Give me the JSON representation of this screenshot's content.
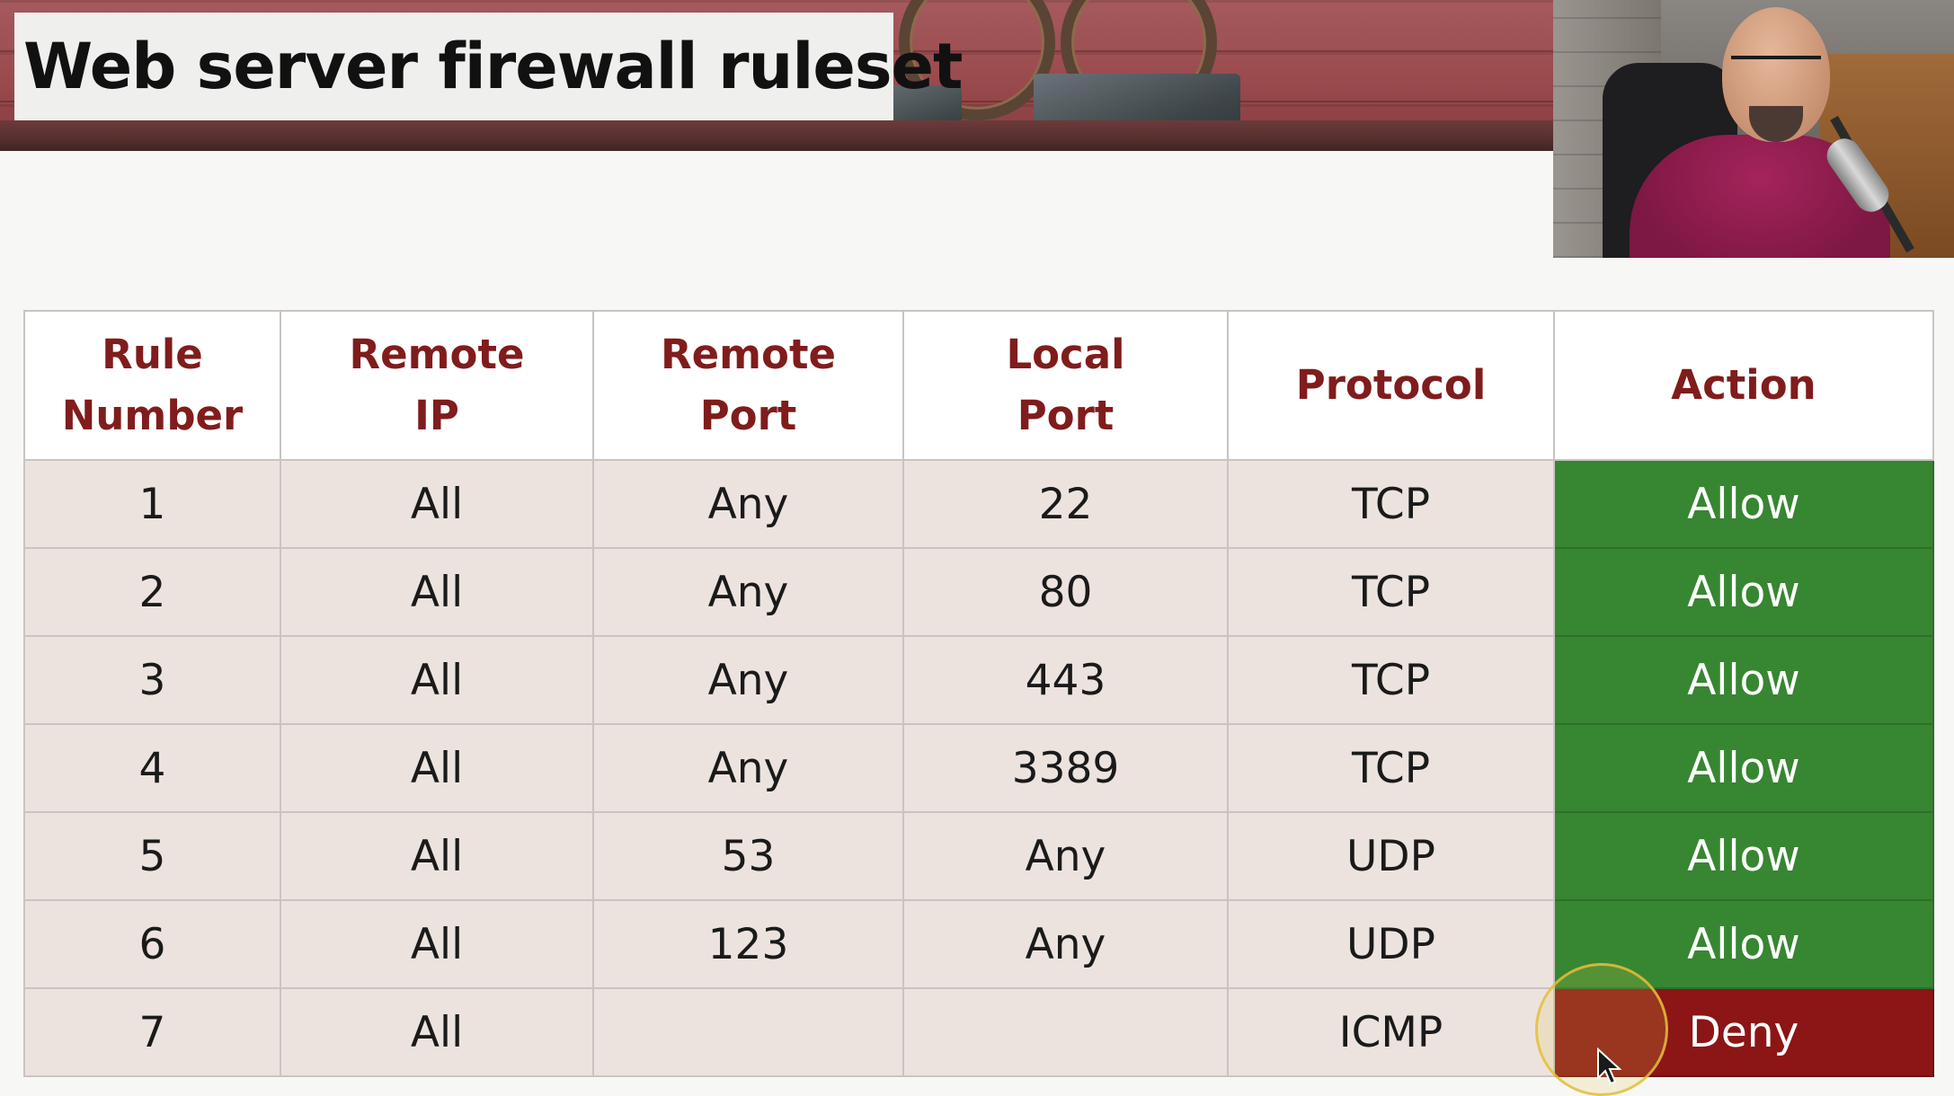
{
  "slide": {
    "title": "Web server firewall ruleset"
  },
  "table": {
    "headers": [
      [
        "Rule",
        "Number"
      ],
      [
        "Remote",
        "IP"
      ],
      [
        "Remote",
        "Port"
      ],
      [
        "Local",
        "Port"
      ],
      [
        "Protocol"
      ],
      [
        "Action"
      ]
    ],
    "rows": [
      {
        "rule": "1",
        "remote_ip": "All",
        "remote_port": "Any",
        "local_port": "22",
        "protocol": "TCP",
        "action": "Allow"
      },
      {
        "rule": "2",
        "remote_ip": "All",
        "remote_port": "Any",
        "local_port": "80",
        "protocol": "TCP",
        "action": "Allow"
      },
      {
        "rule": "3",
        "remote_ip": "All",
        "remote_port": "Any",
        "local_port": "443",
        "protocol": "TCP",
        "action": "Allow"
      },
      {
        "rule": "4",
        "remote_ip": "All",
        "remote_port": "Any",
        "local_port": "3389",
        "protocol": "TCP",
        "action": "Allow"
      },
      {
        "rule": "5",
        "remote_ip": "All",
        "remote_port": "53",
        "local_port": "Any",
        "protocol": "UDP",
        "action": "Allow"
      },
      {
        "rule": "6",
        "remote_ip": "All",
        "remote_port": "123",
        "local_port": "Any",
        "protocol": "UDP",
        "action": "Allow"
      },
      {
        "rule": "7",
        "remote_ip": "All",
        "remote_port": "",
        "local_port": "",
        "protocol": "ICMP",
        "action": "Deny"
      }
    ]
  },
  "colors": {
    "header_text": "#801c1c",
    "allow": "#378632",
    "deny": "#8c1515",
    "row_bg": "#ece3df"
  },
  "icons": {
    "pointer": "arrow-cursor-icon",
    "highlight": "click-highlight-ring"
  }
}
